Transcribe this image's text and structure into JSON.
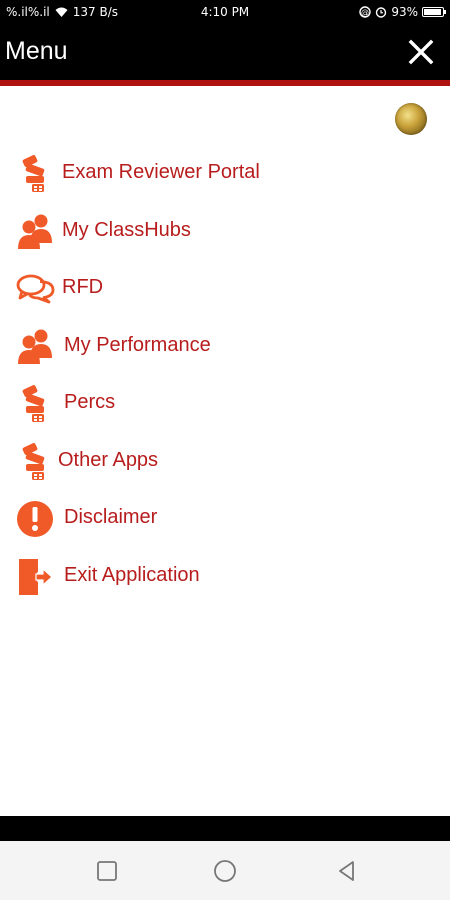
{
  "status_bar": {
    "signal": "%.il%.il",
    "network_speed": "137 B/s",
    "time": "4:10 PM",
    "battery": "93%",
    "battery_level": 0.93
  },
  "header": {
    "title": "Menu"
  },
  "menu": {
    "items": [
      {
        "label": "Exam Reviewer Portal",
        "icon": "book-stack-icon"
      },
      {
        "label": "My ClassHubs",
        "icon": "people-icon"
      },
      {
        "label": "RFD",
        "icon": "chat-bubbles-icon"
      },
      {
        "label": "My Performance",
        "icon": "people-icon"
      },
      {
        "label": "Percs",
        "icon": "book-stack-icon"
      },
      {
        "label": "Other Apps",
        "icon": "book-stack-icon"
      },
      {
        "label": "Disclaimer",
        "icon": "exclamation-icon"
      },
      {
        "label": "Exit Application",
        "icon": "exit-icon"
      }
    ]
  },
  "colors": {
    "accent_red": "#b81d1d",
    "icon_orange": "#f05a28",
    "header_black": "#000000",
    "rule_red": "#b01212"
  }
}
